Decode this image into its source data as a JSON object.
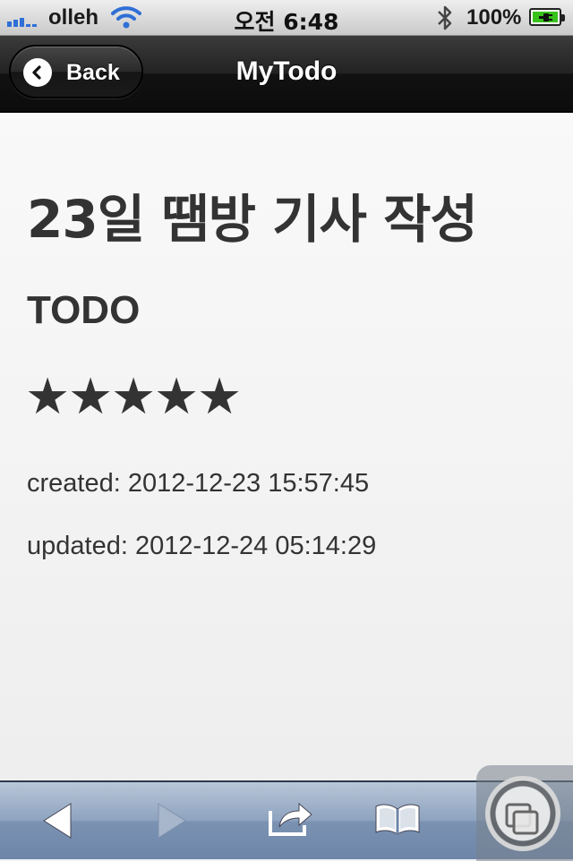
{
  "status_bar": {
    "carrier": "olleh",
    "time": "오전 6:48",
    "battery_percent": "100%",
    "icons": [
      "signal-icon",
      "wifi-icon",
      "bluetooth-icon",
      "battery-charging-icon"
    ]
  },
  "nav": {
    "back_label": "Back",
    "title": "MyTodo"
  },
  "todo": {
    "title": "23일 땜방 기사 작성",
    "status": "TODO",
    "rating": 5,
    "rating_max": 5,
    "stars": [
      "★",
      "★",
      "★",
      "★",
      "★"
    ],
    "created": "created: 2012-12-23 15:57:45",
    "updated": "updated: 2012-12-24 05:14:29"
  },
  "toolbar": {
    "icons": [
      "back-arrow-icon",
      "forward-arrow-icon",
      "share-icon",
      "bookmarks-icon",
      "pages-icon"
    ]
  },
  "colors": {
    "nav_bg": "#1a1a1a",
    "content_bg": "#f2f2f2",
    "text": "#333333",
    "toolbar_bg": "#8ea3bf"
  }
}
